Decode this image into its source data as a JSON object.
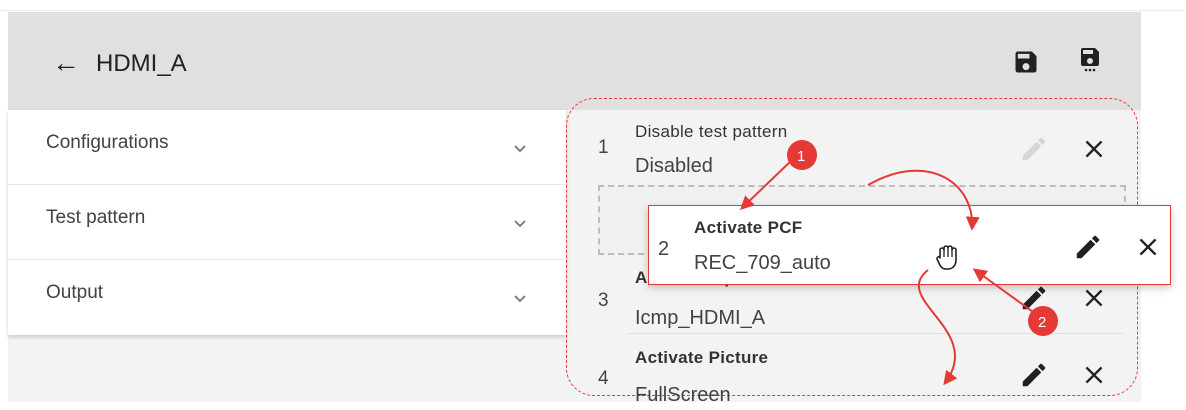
{
  "header": {
    "title": "HDMI_A"
  },
  "accordion": {
    "items": [
      {
        "label": "Configurations"
      },
      {
        "label": "Test pattern"
      },
      {
        "label": "Output"
      }
    ]
  },
  "steps": [
    {
      "index": "1",
      "name": "Disable test pattern",
      "value": "Disabled"
    },
    {
      "index": "2",
      "name": "Activate PCF",
      "value": "REC_709_auto"
    },
    {
      "index": "3",
      "name": "Activate input",
      "value": "Icmp_HDMI_A"
    },
    {
      "index": "4",
      "name": "Activate Picture",
      "value": "FullScreen"
    }
  ],
  "annotations": {
    "badge_1": "1",
    "badge_2": "2"
  },
  "colors": {
    "accent": "#e53935",
    "header_bg": "#e0e0e0",
    "text": "#212121"
  },
  "icons": {
    "back": "arrow-left-icon",
    "save": "save-icon",
    "save_as": "save-as-icon",
    "edit": "pencil-icon",
    "delete": "close-icon",
    "drag": "grab-hand-icon",
    "expand": "chevron-down-icon"
  }
}
